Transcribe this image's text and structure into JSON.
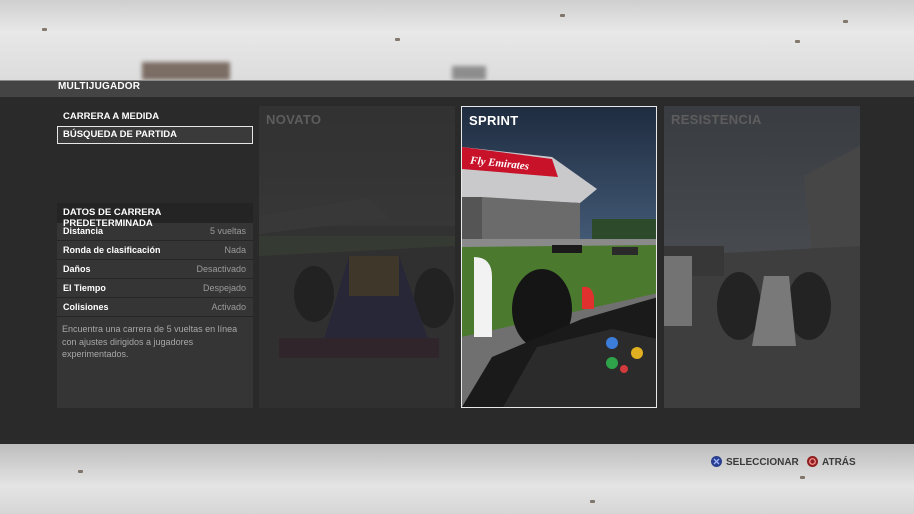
{
  "screen": {
    "title": "MULTIJUGADOR"
  },
  "menu": {
    "items": [
      {
        "label": "CARRERA A MEDIDA",
        "selected": false
      },
      {
        "label": "BÚSQUEDA DE PARTIDA",
        "selected": true
      }
    ]
  },
  "details": {
    "heading": "DATOS DE CARRERA PREDETERMINADA",
    "rows": [
      {
        "key": "Distancia",
        "value": "5 vueltas"
      },
      {
        "key": "Ronda de clasificación",
        "value": "Nada"
      },
      {
        "key": "Daños",
        "value": "Desactivado"
      },
      {
        "key": "El Tiempo",
        "value": "Despejado"
      },
      {
        "key": "Colisiones",
        "value": "Activado"
      }
    ],
    "description": "Encuentra una carrera de 5 vueltas en línea con ajustes dirigidos a jugadores experimentados."
  },
  "modes": [
    {
      "label": "NOVATO",
      "selected": false
    },
    {
      "label": "SPRINT",
      "selected": true,
      "banner_text": "Fly Emirates"
    },
    {
      "label": "RESISTENCIA",
      "selected": false
    }
  ],
  "footer": {
    "select": {
      "label": "SELECCIONAR",
      "icon": "cross-button-icon",
      "color": "#2a3f8f"
    },
    "back": {
      "label": "ATRÁS",
      "icon": "circle-button-icon",
      "color": "#8f1f1f"
    }
  }
}
